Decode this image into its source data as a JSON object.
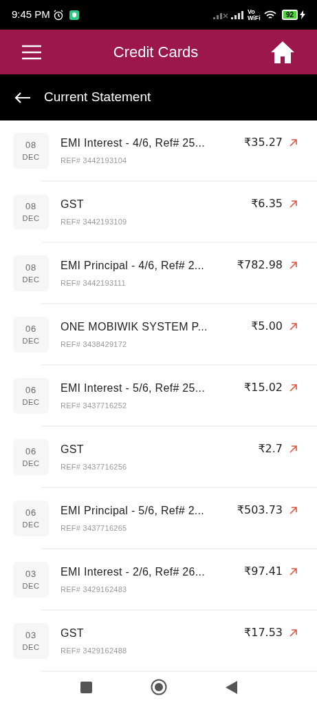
{
  "status_bar": {
    "time": "9:45 PM",
    "network": "Vo WiFi",
    "battery": "92"
  },
  "app_bar": {
    "title": "Credit Cards"
  },
  "sub_header": {
    "title": "Current Statement"
  },
  "transactions": [
    {
      "day": "08",
      "month": "DEC",
      "title": "EMI Interest - 4/6, Ref# 25...",
      "ref": "REF# 3442193104",
      "amount": "₹35.27"
    },
    {
      "day": "08",
      "month": "DEC",
      "title": "GST",
      "ref": "REF# 3442193109",
      "amount": "₹6.35"
    },
    {
      "day": "08",
      "month": "DEC",
      "title": "EMI Principal - 4/6, Ref# 2...",
      "ref": "REF# 3442193111",
      "amount": "₹782.98"
    },
    {
      "day": "06",
      "month": "DEC",
      "title": "ONE MOBIWIK SYSTEM P...",
      "ref": "REF# 3438429172",
      "amount": "₹5.00"
    },
    {
      "day": "06",
      "month": "DEC",
      "title": "EMI Interest - 5/6, Ref# 25...",
      "ref": "REF# 3437716252",
      "amount": "₹15.02"
    },
    {
      "day": "06",
      "month": "DEC",
      "title": "GST",
      "ref": "REF# 3437716256",
      "amount": "₹2.7"
    },
    {
      "day": "06",
      "month": "DEC",
      "title": "EMI Principal - 5/6, Ref# 2...",
      "ref": "REF# 3437716265",
      "amount": "₹503.73"
    },
    {
      "day": "03",
      "month": "DEC",
      "title": "EMI Interest - 2/6, Ref# 26...",
      "ref": "REF# 3429162483",
      "amount": "₹97.41"
    },
    {
      "day": "03",
      "month": "DEC",
      "title": "GST",
      "ref": "REF# 3429162488",
      "amount": "₹17.53"
    }
  ]
}
